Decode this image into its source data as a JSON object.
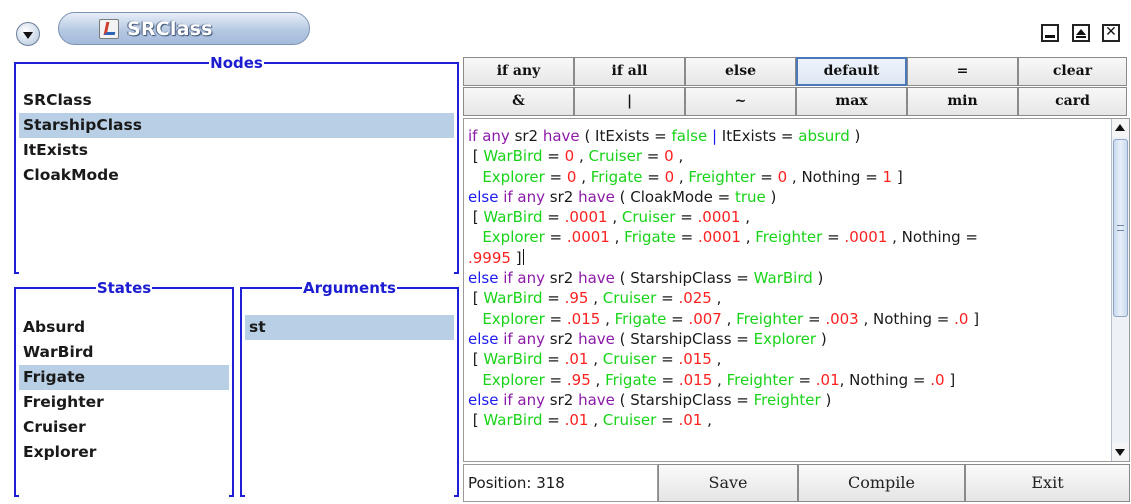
{
  "window": {
    "title": "SRClass",
    "icons": {
      "menu": "chevron-down-icon",
      "app": "java-icon",
      "minimize": "minimize-icon",
      "maximize": "maximize-icon",
      "close": "close-icon"
    },
    "close_glyph": "✕"
  },
  "nodes": {
    "legend": "Nodes",
    "items": [
      {
        "label": "SRClass",
        "selected": false
      },
      {
        "label": "StarshipClass",
        "selected": true
      },
      {
        "label": "ItExists",
        "selected": false
      },
      {
        "label": "CloakMode",
        "selected": false
      }
    ]
  },
  "states": {
    "legend": "States",
    "items": [
      {
        "label": "Absurd",
        "selected": false
      },
      {
        "label": "WarBird",
        "selected": false
      },
      {
        "label": "Frigate",
        "selected": true
      },
      {
        "label": "Freighter",
        "selected": false
      },
      {
        "label": "Cruiser",
        "selected": false
      },
      {
        "label": "Explorer",
        "selected": false
      }
    ]
  },
  "arguments": {
    "legend": "Arguments",
    "items": [
      {
        "label": "st",
        "selected": true
      }
    ]
  },
  "operators": {
    "row1": [
      {
        "label": "if any",
        "pressed": false
      },
      {
        "label": "if all",
        "pressed": false
      },
      {
        "label": "else",
        "pressed": false
      },
      {
        "label": "default",
        "pressed": true
      },
      {
        "label": "=",
        "pressed": false
      },
      {
        "label": "clear",
        "pressed": false
      }
    ],
    "row2": [
      {
        "label": "&",
        "pressed": false
      },
      {
        "label": "|",
        "pressed": false
      },
      {
        "label": "~",
        "pressed": false
      },
      {
        "label": "max",
        "pressed": false
      },
      {
        "label": "min",
        "pressed": false
      },
      {
        "label": "card",
        "pressed": false
      }
    ]
  },
  "editor": {
    "colors": {
      "keyword": "#8c1aa8",
      "value": "#18d418",
      "number": "#ff2020",
      "operator": "#1c1cf0"
    },
    "lines": [
      [
        [
          "kw",
          "if any "
        ],
        [
          "id",
          "sr2 "
        ],
        [
          "kw",
          "have "
        ],
        [
          "id",
          "( ItExists = "
        ],
        [
          "val",
          "false"
        ],
        [
          "kwb",
          " | "
        ],
        [
          "id",
          "ItExists = "
        ],
        [
          "val",
          "absurd"
        ],
        [
          "id",
          " )"
        ]
      ],
      [
        [
          "id",
          " [ "
        ],
        [
          "val",
          "WarBird"
        ],
        [
          "id",
          " = "
        ],
        [
          "num",
          "0"
        ],
        [
          "id",
          " , "
        ],
        [
          "val",
          "Cruiser"
        ],
        [
          "id",
          " = "
        ],
        [
          "num",
          "0"
        ],
        [
          "id",
          " ,"
        ]
      ],
      [
        [
          "id",
          "   "
        ],
        [
          "val",
          "Explorer"
        ],
        [
          "id",
          " = "
        ],
        [
          "num",
          "0"
        ],
        [
          "id",
          " , "
        ],
        [
          "val",
          "Frigate"
        ],
        [
          "id",
          " = "
        ],
        [
          "num",
          "0"
        ],
        [
          "id",
          " , "
        ],
        [
          "val",
          "Freighter"
        ],
        [
          "id",
          " = "
        ],
        [
          "num",
          "0"
        ],
        [
          "id",
          " , Nothing = "
        ],
        [
          "num",
          "1"
        ],
        [
          "id",
          " ]"
        ]
      ],
      [
        [
          "kwb",
          "else "
        ],
        [
          "kw",
          "if any "
        ],
        [
          "id",
          "sr2 "
        ],
        [
          "kw",
          "have "
        ],
        [
          "id",
          "( CloakMode = "
        ],
        [
          "val",
          "true"
        ],
        [
          "id",
          " )"
        ]
      ],
      [
        [
          "id",
          " [ "
        ],
        [
          "val",
          "WarBird"
        ],
        [
          "id",
          " = "
        ],
        [
          "num",
          ".0001"
        ],
        [
          "id",
          " , "
        ],
        [
          "val",
          "Cruiser"
        ],
        [
          "id",
          " = "
        ],
        [
          "num",
          ".0001"
        ],
        [
          "id",
          " ,"
        ]
      ],
      [
        [
          "id",
          "   "
        ],
        [
          "val",
          "Explorer"
        ],
        [
          "id",
          " = "
        ],
        [
          "num",
          ".0001"
        ],
        [
          "id",
          " , "
        ],
        [
          "val",
          "Frigate"
        ],
        [
          "id",
          " = "
        ],
        [
          "num",
          ".0001"
        ],
        [
          "id",
          " , "
        ],
        [
          "val",
          "Freighter"
        ],
        [
          "id",
          " = "
        ],
        [
          "num",
          ".0001"
        ],
        [
          "id",
          " , Nothing ="
        ]
      ],
      [
        [
          "num",
          ".9995"
        ],
        [
          "id",
          " ]"
        ],
        [
          "caret",
          ""
        ]
      ],
      [
        [
          "kwb",
          "else "
        ],
        [
          "kw",
          "if any "
        ],
        [
          "id",
          "sr2 "
        ],
        [
          "kw",
          "have "
        ],
        [
          "id",
          "( StarshipClass = "
        ],
        [
          "val",
          "WarBird"
        ],
        [
          "id",
          " )"
        ]
      ],
      [
        [
          "id",
          " [ "
        ],
        [
          "val",
          "WarBird"
        ],
        [
          "id",
          " = "
        ],
        [
          "num",
          ".95"
        ],
        [
          "id",
          " , "
        ],
        [
          "val",
          "Cruiser"
        ],
        [
          "id",
          " = "
        ],
        [
          "num",
          ".025"
        ],
        [
          "id",
          " ,"
        ]
      ],
      [
        [
          "id",
          "   "
        ],
        [
          "val",
          "Explorer"
        ],
        [
          "id",
          " = "
        ],
        [
          "num",
          ".015"
        ],
        [
          "id",
          " , "
        ],
        [
          "val",
          "Frigate"
        ],
        [
          "id",
          " = "
        ],
        [
          "num",
          ".007"
        ],
        [
          "id",
          " , "
        ],
        [
          "val",
          "Freighter"
        ],
        [
          "id",
          " = "
        ],
        [
          "num",
          ".003"
        ],
        [
          "id",
          " , Nothing = "
        ],
        [
          "num",
          ".0"
        ],
        [
          "id",
          " ]"
        ]
      ],
      [
        [
          "kwb",
          "else "
        ],
        [
          "kw",
          "if any "
        ],
        [
          "id",
          "sr2 "
        ],
        [
          "kw",
          "have "
        ],
        [
          "id",
          "( StarshipClass = "
        ],
        [
          "val",
          "Explorer"
        ],
        [
          "id",
          " )"
        ]
      ],
      [
        [
          "id",
          " [ "
        ],
        [
          "val",
          "WarBird"
        ],
        [
          "id",
          " = "
        ],
        [
          "num",
          ".01"
        ],
        [
          "id",
          " , "
        ],
        [
          "val",
          "Cruiser"
        ],
        [
          "id",
          " = "
        ],
        [
          "num",
          ".015"
        ],
        [
          "id",
          " ,"
        ]
      ],
      [
        [
          "id",
          "   "
        ],
        [
          "val",
          "Explorer"
        ],
        [
          "id",
          " = "
        ],
        [
          "num",
          ".95"
        ],
        [
          "id",
          " , "
        ],
        [
          "val",
          "Frigate"
        ],
        [
          "id",
          " = "
        ],
        [
          "num",
          ".015"
        ],
        [
          "id",
          " , "
        ],
        [
          "val",
          "Freighter"
        ],
        [
          "id",
          " = "
        ],
        [
          "num",
          ".01"
        ],
        [
          "id",
          ", Nothing = "
        ],
        [
          "num",
          ".0"
        ],
        [
          "id",
          " ]"
        ]
      ],
      [
        [
          "kwb",
          "else "
        ],
        [
          "kw",
          "if any "
        ],
        [
          "id",
          "sr2 "
        ],
        [
          "kw",
          "have "
        ],
        [
          "id",
          "( StarshipClass = "
        ],
        [
          "val",
          "Freighter"
        ],
        [
          "id",
          " )"
        ]
      ],
      [
        [
          "id",
          " [ "
        ],
        [
          "val",
          "WarBird"
        ],
        [
          "id",
          " = "
        ],
        [
          "num",
          ".01"
        ],
        [
          "id",
          " , "
        ],
        [
          "val",
          "Cruiser"
        ],
        [
          "id",
          " = "
        ],
        [
          "num",
          ".01"
        ],
        [
          "id",
          " ,"
        ]
      ]
    ],
    "scroll_position": 0.3
  },
  "status": {
    "position_label": "Position: 318"
  },
  "actions": {
    "save": "Save",
    "compile": "Compile",
    "exit": "Exit"
  }
}
